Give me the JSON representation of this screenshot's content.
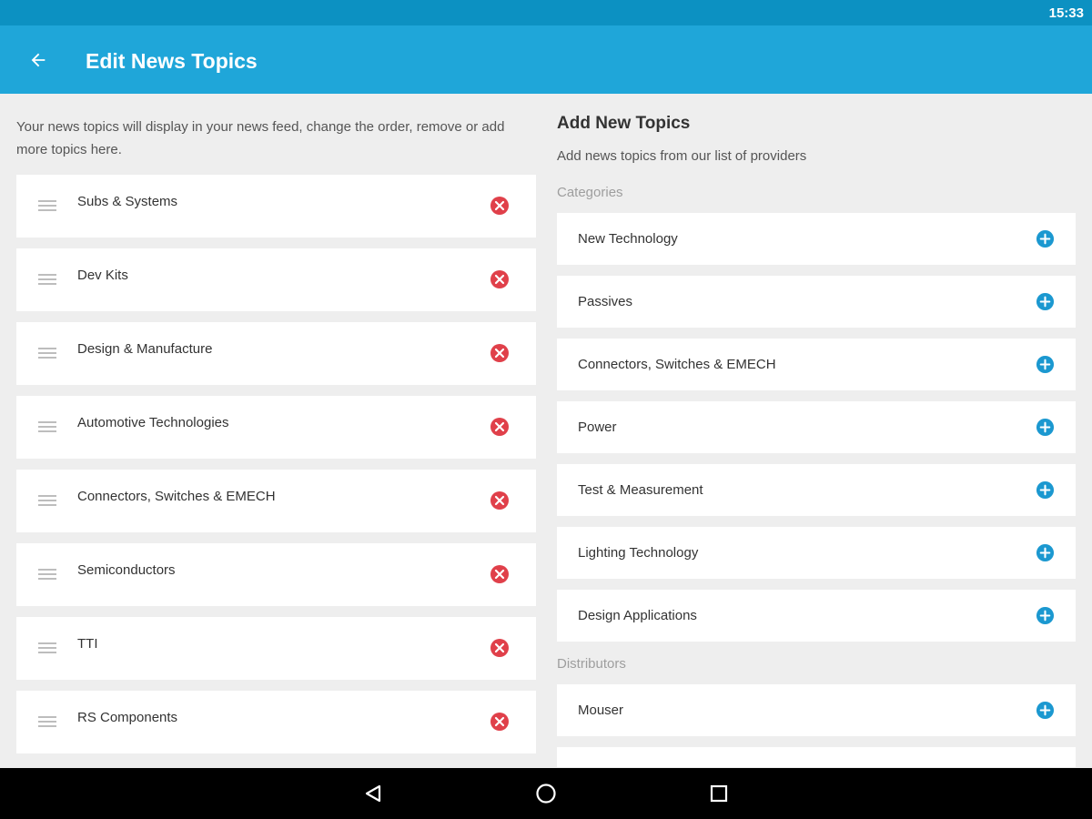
{
  "status_bar": {
    "time": "15:33"
  },
  "app_bar": {
    "title": "Edit News Topics",
    "back_icon": "arrow-back-icon"
  },
  "left_panel": {
    "description": "Your news topics will display in your news feed, change the order, remove or add more topics here.",
    "topics": [
      {
        "label": "Subs & Systems"
      },
      {
        "label": "Dev Kits"
      },
      {
        "label": "Design & Manufacture"
      },
      {
        "label": "Automotive Technologies"
      },
      {
        "label": "Connectors, Switches & EMECH"
      },
      {
        "label": "Semiconductors"
      },
      {
        "label": "TTI"
      },
      {
        "label": "RS Components"
      }
    ]
  },
  "right_panel": {
    "title": "Add New Topics",
    "description": "Add news topics from our list of providers",
    "categories_label": "Categories",
    "categories": [
      {
        "label": "New Technology"
      },
      {
        "label": "Passives"
      },
      {
        "label": "Connectors, Switches & EMECH"
      },
      {
        "label": "Power"
      },
      {
        "label": "Test & Measurement"
      },
      {
        "label": "Lighting Technology"
      },
      {
        "label": "Design Applications"
      }
    ],
    "distributors_label": "Distributors",
    "distributors": [
      {
        "label": "Mouser"
      }
    ]
  },
  "colors": {
    "status_bar": "#0c91c2",
    "app_bar": "#1fa6d9",
    "remove": "#e0404a",
    "add": "#1b98d0",
    "background": "#eeeeee"
  },
  "nav_icons": [
    "back-triangle-icon",
    "home-circle-icon",
    "recents-square-icon"
  ]
}
